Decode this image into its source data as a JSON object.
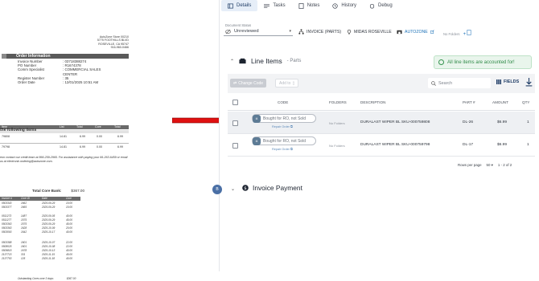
{
  "document": {
    "address": [
      "AutoZone Store 00210",
      "5775 FOOTHILLS BLVD",
      "ROSEVILLE, CA 95747",
      "916-960-0466"
    ],
    "order_info_title": "Order Information",
    "fields": [
      {
        "k": "Invoice Number",
        "v": ": 03718388274"
      },
      {
        "k": "PO Number",
        "v": ": R1674378"
      },
      {
        "k": "Comm Specialist",
        "v": ": COMMERCIAL SALES"
      },
      {
        "k": "",
        "v": "CENTER"
      },
      {
        "k": "Register Number",
        "v": ": 35"
      },
      {
        "k": "Order Date",
        "v": ": 12/01/2025 10:51 AM"
      }
    ],
    "table_head": [
      "Item",
      "List",
      "Total",
      "Core",
      "Total"
    ],
    "following_items": "the following items",
    "rows": [
      {
        "c0": "79808",
        "c1": "14.81",
        "c2": "6.99",
        "c3": "0.00",
        "c4": "6.99"
      },
      {
        "c0": "79798",
        "c1": "14.81",
        "c2": "6.99",
        "c3": "0.00",
        "c4": "6.99"
      }
    ],
    "note": "eon contact our credit team at 866-259-2965. For assistance with paying your 66-263-6459 or email us at electronic.ordering@autozone.com.",
    "core_total_label": "Total Core Bank:",
    "core_total_value": "$367.00",
    "core_head": [
      "Invoice #",
      "Core ID",
      "Date",
      "Core"
    ],
    "core_rows": [
      [
        "0503343",
        "1662",
        "2025-09-29",
        "10.00"
      ],
      [
        "0503377",
        "1665",
        "2025-09-29",
        "10.00"
      ],
      [
        "",
        "",
        "",
        ""
      ],
      [
        "0511273",
        "1487",
        "2025-09-05",
        "40.00"
      ],
      [
        "0511277",
        "1575",
        "2025-09-29",
        "45.00"
      ],
      [
        "0503363",
        "1575",
        "2025-09-29",
        "45.00"
      ],
      [
        "0503363",
        "1628",
        "2025-10-09",
        "20.00"
      ],
      [
        "0503093",
        "1642",
        "2025-10-17",
        "40.00"
      ],
      [
        "",
        "",
        "",
        ""
      ],
      [
        "0503388",
        "1601",
        "2025-10-07",
        "22.00"
      ],
      [
        "0508025",
        "1601",
        "2025-10-08",
        "22.00"
      ],
      [
        "0509815",
        "1678",
        "2025-10-13",
        "40.00"
      ],
      [
        "2137723",
        "331",
        "2025-11-15",
        "45.00"
      ],
      [
        "2137753",
        "125",
        "2025-11-18",
        "40.00"
      ]
    ],
    "outstanding_label": "Outstanding Cores over 3 days:",
    "outstanding_value": "$367.00"
  },
  "tabs": [
    {
      "label": "Details",
      "icon": "details-icon"
    },
    {
      "label": "Tasks",
      "icon": "tasks-icon"
    },
    {
      "label": "Notes",
      "icon": "notes-icon"
    },
    {
      "label": "History",
      "icon": "history-icon"
    },
    {
      "label": "Debug",
      "icon": "debug-icon"
    }
  ],
  "doc_status": {
    "label": "Document Status",
    "value": "Unreviewed"
  },
  "meta": {
    "invoice_type": "INVOICE (PARTS)",
    "location": "MIDAS ROSEVILLE",
    "vendor": "AUTOZONE",
    "no_folders": "No Folders"
  },
  "line_items": {
    "title": "Line Items",
    "subtitle": "- Parts",
    "accounted": "All line items are accounted for!",
    "change_code": "Change Code",
    "add_to": "Add to",
    "search_placeholder": "Search",
    "fields_label": "FIELDS",
    "columns": [
      "CODE",
      "FOLDERS",
      "DESCRIPTION",
      "PART #",
      "AMOUNT",
      "QTY"
    ],
    "rows": [
      {
        "badge": "I4",
        "code": "Bought for RO, not Sold",
        "repair": "Repair Order",
        "folders": "No Folders",
        "description": "DURALAST WIPER BL SKU-000759808",
        "part": "DL-26",
        "amount": "$6.99",
        "qty": "1"
      },
      {
        "badge": "I4",
        "code": "Bought for RO, not Sold",
        "repair": "Repair Order",
        "folders": "No Folders",
        "description": "DURALAST WIPER BL SKU-000759798",
        "part": "DL-17",
        "amount": "$6.99",
        "qty": "1"
      }
    ],
    "rows_per_page_label": "Rows per page",
    "rows_per_page_value": "50",
    "pagination": "1 - 2 of 2"
  },
  "invoice_payment": {
    "badge": "B",
    "title": "Invoice Payment"
  },
  "colors": {
    "accent": "#1d72b8",
    "success": "#2f8a48",
    "arrow": "#e01010"
  }
}
